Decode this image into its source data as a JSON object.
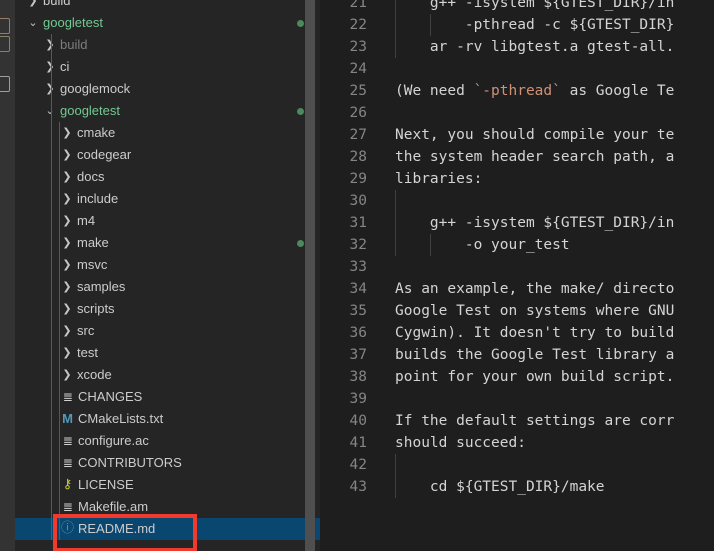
{
  "activity_bar": {
    "icons": [
      "explorer-icon",
      "search-icon",
      "source-control-icon"
    ]
  },
  "sidebar": {
    "scrollbar": "visible",
    "tree": [
      {
        "label": "build",
        "kind": "folder",
        "state": "collapsed",
        "depth": 1,
        "dim": false,
        "dot": false,
        "clipped_top": true
      },
      {
        "label": "googletest",
        "kind": "folder",
        "state": "expanded",
        "depth": 1,
        "dim": false,
        "dot": true
      },
      {
        "label": "build",
        "kind": "folder",
        "state": "collapsed",
        "depth": 2,
        "dim": true,
        "dot": false
      },
      {
        "label": "ci",
        "kind": "folder",
        "state": "collapsed",
        "depth": 2,
        "dim": false,
        "dot": false
      },
      {
        "label": "googlemock",
        "kind": "folder",
        "state": "collapsed",
        "depth": 2,
        "dim": false,
        "dot": false
      },
      {
        "label": "googletest",
        "kind": "folder",
        "state": "expanded",
        "depth": 2,
        "dim": false,
        "dot": true
      },
      {
        "label": "cmake",
        "kind": "folder",
        "state": "collapsed",
        "depth": 3,
        "dim": false,
        "dot": false
      },
      {
        "label": "codegear",
        "kind": "folder",
        "state": "collapsed",
        "depth": 3,
        "dim": false,
        "dot": false
      },
      {
        "label": "docs",
        "kind": "folder",
        "state": "collapsed",
        "depth": 3,
        "dim": false,
        "dot": false
      },
      {
        "label": "include",
        "kind": "folder",
        "state": "collapsed",
        "depth": 3,
        "dim": false,
        "dot": false
      },
      {
        "label": "m4",
        "kind": "folder",
        "state": "collapsed",
        "depth": 3,
        "dim": false,
        "dot": false
      },
      {
        "label": "make",
        "kind": "folder",
        "state": "collapsed",
        "depth": 3,
        "dim": false,
        "dot": true
      },
      {
        "label": "msvc",
        "kind": "folder",
        "state": "collapsed",
        "depth": 3,
        "dim": false,
        "dot": false
      },
      {
        "label": "samples",
        "kind": "folder",
        "state": "collapsed",
        "depth": 3,
        "dim": false,
        "dot": false
      },
      {
        "label": "scripts",
        "kind": "folder",
        "state": "collapsed",
        "depth": 3,
        "dim": false,
        "dot": false
      },
      {
        "label": "src",
        "kind": "folder",
        "state": "collapsed",
        "depth": 3,
        "dim": false,
        "dot": false
      },
      {
        "label": "test",
        "kind": "folder",
        "state": "collapsed",
        "depth": 3,
        "dim": false,
        "dot": false
      },
      {
        "label": "xcode",
        "kind": "folder",
        "state": "collapsed",
        "depth": 3,
        "dim": false,
        "dot": false
      },
      {
        "label": "CHANGES",
        "kind": "file",
        "icon": "text-file-icon",
        "depth": 3,
        "dim": false,
        "dot": false
      },
      {
        "label": "CMakeLists.txt",
        "kind": "file",
        "icon": "cmake-file-icon",
        "depth": 3,
        "dim": false,
        "dot": false
      },
      {
        "label": "configure.ac",
        "kind": "file",
        "icon": "text-file-icon",
        "depth": 3,
        "dim": false,
        "dot": false
      },
      {
        "label": "CONTRIBUTORS",
        "kind": "file",
        "icon": "text-file-icon",
        "depth": 3,
        "dim": false,
        "dot": false
      },
      {
        "label": "LICENSE",
        "kind": "file",
        "icon": "license-key-icon",
        "depth": 3,
        "dim": false,
        "dot": false
      },
      {
        "label": "Makefile.am",
        "kind": "file",
        "icon": "text-file-icon",
        "depth": 3,
        "dim": false,
        "dot": false
      },
      {
        "label": "README.md",
        "kind": "file",
        "icon": "markdown-info-icon",
        "depth": 3,
        "dim": false,
        "dot": false,
        "selected": true
      }
    ],
    "glyphs": {
      "chevron_right": "❯",
      "chevron_down": "⌄",
      "text_file": "≣",
      "cmake": "M",
      "key": "⚷",
      "info": "ⓘ"
    }
  },
  "annotation": {
    "color": "#f03a2e",
    "target": "README.md"
  },
  "editor": {
    "file": "README.md",
    "first_visible_line": 21,
    "lines": [
      {
        "n": 21,
        "indent_guides": [
          0
        ],
        "segments": [
          {
            "t": "    g++ -isystem ${GTEST_DIR}/in",
            "k": "plain"
          }
        ]
      },
      {
        "n": 22,
        "indent_guides": [
          0,
          1
        ],
        "segments": [
          {
            "t": "        -pthread -c ${GTEST_DIR}",
            "k": "plain"
          }
        ]
      },
      {
        "n": 23,
        "indent_guides": [
          0
        ],
        "segments": [
          {
            "t": "    ar -rv libgtest.a gtest-all.",
            "k": "plain"
          }
        ]
      },
      {
        "n": 24,
        "indent_guides": [],
        "segments": [
          {
            "t": "",
            "k": "plain"
          }
        ]
      },
      {
        "n": 25,
        "indent_guides": [],
        "segments": [
          {
            "t": "(We need ",
            "k": "plain"
          },
          {
            "t": "`-pthread`",
            "k": "code"
          },
          {
            "t": " as Google Te",
            "k": "plain"
          }
        ]
      },
      {
        "n": 26,
        "indent_guides": [],
        "segments": [
          {
            "t": "",
            "k": "plain"
          }
        ]
      },
      {
        "n": 27,
        "indent_guides": [],
        "segments": [
          {
            "t": "Next, you should compile your te",
            "k": "plain"
          }
        ]
      },
      {
        "n": 28,
        "indent_guides": [],
        "segments": [
          {
            "t": "the system header search path, a",
            "k": "plain"
          }
        ]
      },
      {
        "n": 29,
        "indent_guides": [],
        "segments": [
          {
            "t": "libraries:",
            "k": "plain"
          }
        ]
      },
      {
        "n": 30,
        "indent_guides": [
          0
        ],
        "segments": [
          {
            "t": "",
            "k": "plain"
          }
        ]
      },
      {
        "n": 31,
        "indent_guides": [
          0
        ],
        "segments": [
          {
            "t": "    g++ -isystem ${GTEST_DIR}/in",
            "k": "plain"
          }
        ]
      },
      {
        "n": 32,
        "indent_guides": [
          0,
          1
        ],
        "segments": [
          {
            "t": "        -o your_test",
            "k": "plain"
          }
        ]
      },
      {
        "n": 33,
        "indent_guides": [],
        "segments": [
          {
            "t": "",
            "k": "plain"
          }
        ]
      },
      {
        "n": 34,
        "indent_guides": [],
        "segments": [
          {
            "t": "As an example, the make/ directo",
            "k": "plain"
          }
        ]
      },
      {
        "n": 35,
        "indent_guides": [],
        "segments": [
          {
            "t": "Google Test on systems where GNU",
            "k": "plain"
          }
        ]
      },
      {
        "n": 36,
        "indent_guides": [],
        "segments": [
          {
            "t": "Cygwin). It doesn't try to build",
            "k": "plain"
          }
        ]
      },
      {
        "n": 37,
        "indent_guides": [],
        "segments": [
          {
            "t": "builds the Google Test library a",
            "k": "plain"
          }
        ]
      },
      {
        "n": 38,
        "indent_guides": [],
        "segments": [
          {
            "t": "point for your own build script.",
            "k": "plain"
          }
        ]
      },
      {
        "n": 39,
        "indent_guides": [],
        "segments": [
          {
            "t": "",
            "k": "plain"
          }
        ]
      },
      {
        "n": 40,
        "indent_guides": [],
        "segments": [
          {
            "t": "If the default settings are corr",
            "k": "plain"
          }
        ]
      },
      {
        "n": 41,
        "indent_guides": [],
        "segments": [
          {
            "t": "should succeed:",
            "k": "plain"
          }
        ]
      },
      {
        "n": 42,
        "indent_guides": [
          0
        ],
        "segments": [
          {
            "t": "",
            "k": "plain"
          }
        ]
      },
      {
        "n": 43,
        "indent_guides": [
          0
        ],
        "segments": [
          {
            "t": "    cd ${GTEST_DIR}/make",
            "k": "plain"
          }
        ]
      }
    ]
  },
  "colors": {
    "editor_bg": "#1e1e1e",
    "sidebar_bg": "#252526",
    "activitybar_bg": "#333333",
    "selection_bg": "#094771",
    "folder_open_fg": "#73c991",
    "text_fg": "#cccccc",
    "dim_fg": "#7d7d7d",
    "line_number_fg": "#858585",
    "code_fg": "#ce9178",
    "git_dot": "#4a8a5c",
    "annotation": "#f03a2e"
  }
}
